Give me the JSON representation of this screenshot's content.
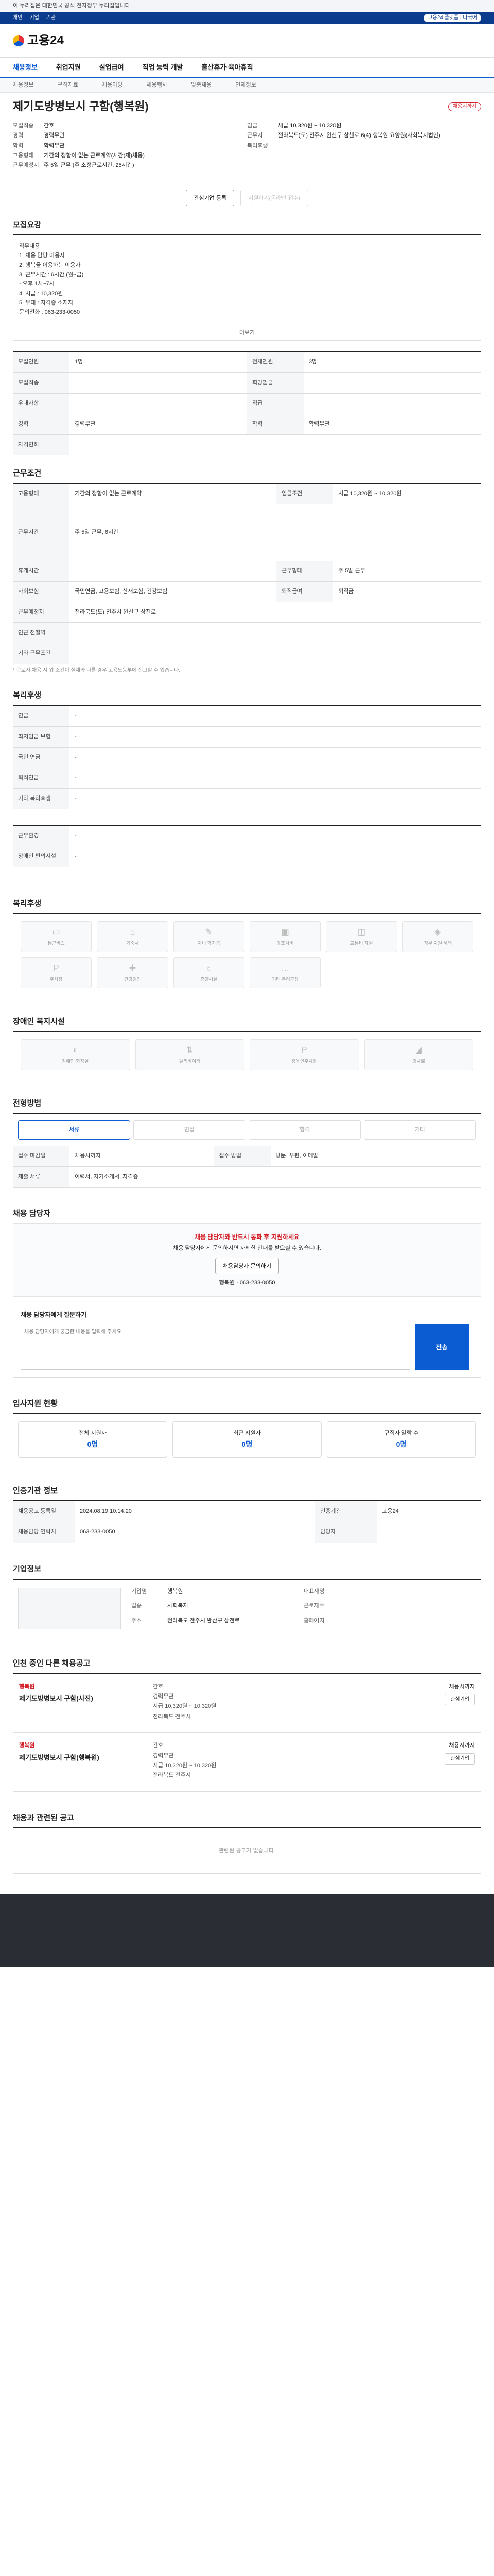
{
  "gov_banner": "이 누리집은 대한민국 공식 전자정부 누리집입니다.",
  "util": {
    "links": [
      "개인",
      "기업",
      "기관"
    ],
    "right": "고용24 플랫폼 | 다국어"
  },
  "logo": "고용24",
  "gnb": [
    "채용정보",
    "취업지원",
    "실업급여",
    "직업 능력 개발",
    "출산휴가·육아휴직"
  ],
  "subnav": [
    "채용정보",
    "구직자료",
    "채용마당",
    "채용행사",
    "맞춤채용",
    "인재정보"
  ],
  "title": "제기도방병보시 구함(행복원)",
  "badge": "채용시까지",
  "summary": {
    "left": [
      [
        "모집직종",
        "간호"
      ],
      [
        "경력",
        "경력무관"
      ],
      [
        "학력",
        "학력무관"
      ],
      [
        "고용형태",
        "기간의 정함이 없는 근로계약(시간(제)채용)"
      ],
      [
        "근무예정지",
        "주 5일 근무 (주 소정근로시간: 25시간)"
      ]
    ],
    "right": [
      [
        "임금",
        "시급 10,320원 ~ 10,320원"
      ],
      [
        "근무지",
        "전라북도(도) 전주시 완산구 삼천로 6(4) 행복원 요양원(사회복지법인)"
      ],
      [
        "복리후생",
        ""
      ]
    ]
  },
  "actions": {
    "interest": "관심기업 등록",
    "apply": "지원하기(온라인 접수)"
  },
  "sections": {
    "content": "모집요강",
    "conditions": "근무조건",
    "welfare": "복리후생",
    "disability": "장애인 복지시설",
    "process": "전형방법",
    "contact": "채용 담당자",
    "status": "입사지원 현황",
    "agency": "인증기관 정보",
    "company": "기업정보",
    "same": "인천 중인 다른 채용공고",
    "related": "채용과 관련된 공고"
  },
  "content_lines": [
    "직무내용",
    "1. 채용 담당 이용자",
    "2. 행복을 이용하는 이용자",
    "3. 근무시간 : 6시간 (월~금)",
    "  - 오후 1시~7시",
    "4. 시급 : 10,320원",
    "5. 우대 : 자격증 소지자",
    "",
    "문의전화 : 063-233-0050"
  ],
  "more": "더보기",
  "table1": [
    [
      "모집인원",
      "1명",
      "전체인원",
      "3명"
    ],
    [
      "모집직종",
      "",
      "희망임금",
      ""
    ],
    [
      "우대사항",
      "",
      "직급",
      ""
    ],
    [
      "경력",
      "경력무관",
      "학력",
      "학력무관"
    ],
    [
      "자격면허",
      "",
      "",
      ""
    ]
  ],
  "table2": [
    [
      "고용형태",
      "기간의 정함이 없는 근로계약",
      "임금조건",
      "시급 10,320원 ~ 10,320원"
    ],
    [
      "근무시간",
      "주 5일 근무, 6시간",
      "",
      ""
    ],
    [
      "휴게시간",
      "",
      "근무형태",
      "주 5일 근무"
    ],
    [
      "사회보험",
      "국민연금, 고용보험, 산재보험, 건강보험",
      "퇴직급여",
      "퇴직금"
    ],
    [
      "근무예정지",
      "전라북도(도) 전주시 완산구 삼천로",
      "",
      ""
    ],
    [
      "인근 전철역",
      "",
      "",
      ""
    ],
    [
      "기타 근무조건",
      "",
      "",
      ""
    ]
  ],
  "note1": "* 근로자 채용 시 위 조건이 실제와 다른 경우 고용노동부에 신고할 수 있습니다.",
  "table3": [
    [
      "연금",
      "-"
    ],
    [
      "최저임금 보험",
      "-"
    ],
    [
      "국민 연금",
      "-"
    ],
    [
      "퇴직연금",
      "-"
    ],
    [
      "기타 복리후생",
      "-"
    ]
  ],
  "table4": [
    [
      "근무환경",
      "-"
    ],
    [
      "장애인 편의시설",
      "-"
    ]
  ],
  "welfare_icons": [
    "통근버스",
    "기숙사",
    "자녀 학자금",
    "경조사비",
    "교통비 지원",
    "정부 지원 혜택",
    "주차장",
    "건강검진",
    "휴양시설",
    "기타 복리후생"
  ],
  "disability_icons": [
    "장애인 화장실",
    "엘리베이터",
    "장애인주차장",
    "경사로"
  ],
  "process_steps": [
    "서류",
    "면접",
    "합격",
    "기타"
  ],
  "process_info": [
    [
      "접수 마감일",
      "채용시까지",
      "접수 방법",
      "방문, 우편, 이메일"
    ],
    [
      "제출 서류",
      "이력서, 자기소개서, 자격증",
      "",
      ""
    ]
  ],
  "contact": {
    "warn": "채용 담당자와 반드시 통화 후 지원하세요",
    "line1": "채용 담당자에게 문의하시면 자세한 안내를 받으실 수 있습니다.",
    "button": "채용담당자 문의하기",
    "name": "행복원",
    "phone": "063-233-0050"
  },
  "inquiry": {
    "title": "채용 담당자에게 질문하기",
    "placeholder": "채용 담당자에게 궁금한 내용을 입력해 주세요.",
    "send": "전송"
  },
  "status": [
    [
      "전체 지원자",
      "0명"
    ],
    [
      "최근 지원자",
      "0명"
    ],
    [
      "구직자 열람 수",
      "0명"
    ]
  ],
  "agency": [
    [
      "채용공고 등록일",
      "2024.08.19 10:14:20",
      "인증기관",
      "고용24"
    ],
    [
      "채용담당 연락처",
      "063-233-0050",
      "담당자",
      ""
    ]
  ],
  "company": {
    "k1": "기업명",
    "v1": "행복원",
    "k2": "대표자명",
    "v2": "",
    "k3": "업종",
    "v3": "사회복지",
    "k4": "근로자수",
    "v4": "",
    "k5": "주소",
    "v5": "전라북도 전주시 완산구 삼천로",
    "k6": "홈페이지",
    "v6": ""
  },
  "jobs": [
    {
      "company": "행복원",
      "title": "제기도방병보시 구함(사진)",
      "lines": [
        "간호",
        "경력무관",
        "시급 10,320원 ~ 10,320원",
        "전라북도 전주시"
      ],
      "deadline": "채용시까지",
      "btn": "관심기업"
    },
    {
      "company": "행복원",
      "title": "제기도방병보시 구함(행복원)",
      "lines": [
        "간호",
        "경력무관",
        "시급 10,320원 ~ 10,320원",
        "전라북도 전주시"
      ],
      "deadline": "채용시까지",
      "btn": "관심기업"
    }
  ],
  "empty": "관련된 공고가 없습니다."
}
